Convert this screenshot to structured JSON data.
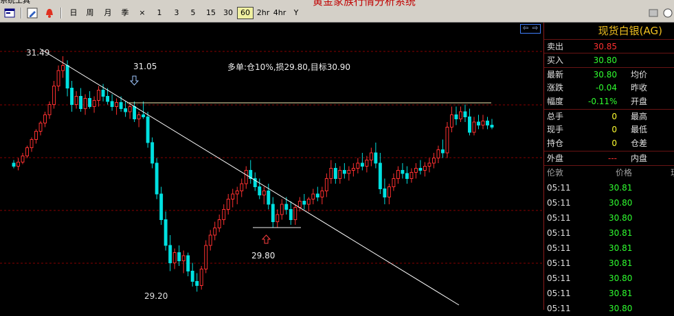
{
  "overlay_title": "黄金家族行情分析系统",
  "toolbar": {
    "periods": [
      "日",
      "周",
      "月",
      "季"
    ],
    "close_label": "×",
    "minutes": [
      "1",
      "3",
      "5",
      "15",
      "30",
      "60",
      "2hr",
      "4hr",
      "Y"
    ],
    "selected": "60"
  },
  "chart": {
    "high_label": "31.49",
    "low_label": "29.20",
    "entry_label": "29.80",
    "resistance_label": "31.05",
    "note": "多单:仓10%,损29.80,目标30.90"
  },
  "panel": {
    "title": "现货白银(AG)",
    "sell_label": "卖出",
    "sell_value": "30.85",
    "buy_label": "买入",
    "buy_value": "30.80",
    "latest_label": "最新",
    "latest_value": "30.80",
    "avg_label": "均价",
    "change_label": "涨跌",
    "change_value": "-0.04",
    "prev_close_label": "昨收",
    "amplitude_label": "幅度",
    "amplitude_value": "-0.11%",
    "open_label": "开盘",
    "total_label": "总手",
    "total_value": "0",
    "high_label": "最高",
    "current_label": "现手",
    "current_value": "0",
    "low_label": "最低",
    "position_label": "持仓",
    "position_value": "0",
    "position_diff_label": "仓差",
    "outer_label": "外盘",
    "outer_value": "---",
    "inner_label": "内盘",
    "col_time": "伦敦",
    "col_price": "价格",
    "ticks": [
      {
        "time": "05:11",
        "price": "30.81"
      },
      {
        "time": "05:11",
        "price": "30.80"
      },
      {
        "time": "05:11",
        "price": "30.80"
      },
      {
        "time": "05:11",
        "price": "30.81"
      },
      {
        "time": "05:11",
        "price": "30.81"
      },
      {
        "time": "05:11",
        "price": "30.81"
      },
      {
        "time": "05:11",
        "price": "30.80"
      },
      {
        "time": "05:11",
        "price": "30.81"
      },
      {
        "time": "05:11",
        "price": "30.80"
      }
    ]
  },
  "colors": {
    "up": "#ff3030",
    "down": "#00e0e0",
    "grid": "#8a0000"
  },
  "chart_data": {
    "type": "candlestick",
    "symbol": "现货白银(AG)",
    "period": "60",
    "ylim": [
      29.15,
      31.55
    ],
    "candles": [
      [
        30.45,
        30.48,
        30.4,
        30.42
      ],
      [
        30.42,
        30.5,
        30.38,
        30.46
      ],
      [
        30.46,
        30.55,
        30.44,
        30.52
      ],
      [
        30.52,
        30.62,
        30.5,
        30.6
      ],
      [
        30.6,
        30.7,
        30.56,
        30.68
      ],
      [
        30.68,
        30.78,
        30.64,
        30.76
      ],
      [
        30.76,
        30.86,
        30.72,
        30.84
      ],
      [
        30.84,
        30.95,
        30.8,
        30.92
      ],
      [
        30.92,
        31.05,
        30.88,
        31.02
      ],
      [
        31.02,
        31.25,
        30.98,
        31.2
      ],
      [
        31.2,
        31.4,
        31.15,
        31.35
      ],
      [
        31.35,
        31.49,
        31.28,
        31.4
      ],
      [
        31.4,
        31.45,
        31.1,
        31.18
      ],
      [
        31.18,
        31.25,
        30.95,
        31.02
      ],
      [
        31.02,
        31.15,
        30.98,
        31.1
      ],
      [
        31.1,
        31.18,
        30.95,
        30.98
      ],
      [
        30.98,
        31.12,
        30.92,
        31.08
      ],
      [
        31.08,
        31.15,
        30.98,
        31.0
      ],
      [
        31.0,
        31.1,
        30.94,
        31.06
      ],
      [
        31.06,
        31.2,
        31.0,
        31.16
      ],
      [
        31.16,
        31.22,
        31.05,
        31.1
      ],
      [
        31.1,
        31.18,
        31.02,
        31.05
      ],
      [
        31.05,
        31.12,
        30.96,
        31.0
      ],
      [
        31.0,
        31.08,
        30.92,
        31.04
      ],
      [
        31.04,
        31.1,
        30.95,
        30.98
      ],
      [
        30.98,
        31.05,
        30.9,
        30.95
      ],
      [
        30.95,
        31.02,
        30.88,
        31.0
      ],
      [
        31.0,
        31.05,
        30.85,
        30.88
      ],
      [
        30.88,
        30.95,
        30.8,
        30.92
      ],
      [
        30.92,
        31.05,
        30.88,
        30.9
      ],
      [
        30.9,
        30.95,
        30.6,
        30.65
      ],
      [
        30.65,
        30.7,
        30.4,
        30.45
      ],
      [
        30.45,
        30.5,
        30.1,
        30.15
      ],
      [
        30.15,
        30.22,
        29.85,
        29.9
      ],
      [
        29.9,
        29.98,
        29.6,
        29.65
      ],
      [
        29.65,
        29.75,
        29.4,
        29.48
      ],
      [
        29.48,
        29.62,
        29.42,
        29.58
      ],
      [
        29.58,
        29.65,
        29.45,
        29.5
      ],
      [
        29.5,
        29.6,
        29.38,
        29.55
      ],
      [
        29.55,
        29.58,
        29.35,
        29.4
      ],
      [
        29.4,
        29.48,
        29.25,
        29.3
      ],
      [
        29.3,
        29.38,
        29.2,
        29.26
      ],
      [
        29.26,
        29.45,
        29.22,
        29.42
      ],
      [
        29.42,
        29.7,
        29.38,
        29.65
      ],
      [
        29.65,
        29.8,
        29.6,
        29.75
      ],
      [
        29.75,
        29.88,
        29.7,
        29.82
      ],
      [
        29.82,
        29.95,
        29.78,
        29.9
      ],
      [
        29.9,
        30.05,
        29.85,
        30.0
      ],
      [
        30.0,
        30.15,
        29.95,
        30.1
      ],
      [
        30.1,
        30.2,
        30.02,
        30.15
      ],
      [
        30.15,
        30.22,
        30.05,
        30.18
      ],
      [
        30.18,
        30.3,
        30.12,
        30.25
      ],
      [
        30.25,
        30.42,
        30.2,
        30.38
      ],
      [
        30.38,
        30.48,
        30.25,
        30.3
      ],
      [
        30.3,
        30.36,
        30.18,
        30.22
      ],
      [
        30.22,
        30.3,
        30.1,
        30.14
      ],
      [
        30.14,
        30.22,
        30.05,
        30.18
      ],
      [
        30.18,
        30.25,
        30.0,
        30.05
      ],
      [
        30.05,
        30.12,
        29.82,
        29.88
      ],
      [
        29.88,
        30.0,
        29.82,
        29.95
      ],
      [
        29.95,
        30.1,
        29.9,
        30.05
      ],
      [
        30.05,
        30.12,
        29.95,
        30.0
      ],
      [
        30.0,
        30.08,
        29.85,
        29.9
      ],
      [
        29.9,
        30.05,
        29.85,
        30.02
      ],
      [
        30.02,
        30.12,
        29.98,
        30.08
      ],
      [
        30.08,
        30.15,
        30.0,
        30.05
      ],
      [
        30.05,
        30.12,
        29.98,
        30.1
      ],
      [
        30.1,
        30.2,
        30.05,
        30.15
      ],
      [
        30.15,
        30.22,
        30.08,
        30.12
      ],
      [
        30.12,
        30.22,
        30.05,
        30.18
      ],
      [
        30.18,
        30.35,
        30.12,
        30.3
      ],
      [
        30.3,
        30.48,
        30.25,
        30.4
      ],
      [
        30.4,
        30.45,
        30.25,
        30.3
      ],
      [
        30.3,
        30.42,
        30.25,
        30.38
      ],
      [
        30.38,
        30.45,
        30.3,
        30.35
      ],
      [
        30.35,
        30.42,
        30.28,
        30.38
      ],
      [
        30.38,
        30.45,
        30.32,
        30.4
      ],
      [
        30.4,
        30.5,
        30.35,
        30.45
      ],
      [
        30.45,
        30.55,
        30.38,
        30.42
      ],
      [
        30.42,
        30.52,
        30.36,
        30.48
      ],
      [
        30.48,
        30.6,
        30.42,
        30.55
      ],
      [
        30.55,
        30.65,
        30.4,
        30.45
      ],
      [
        30.45,
        30.55,
        30.15,
        30.2
      ],
      [
        30.2,
        30.3,
        30.05,
        30.12
      ],
      [
        30.12,
        30.25,
        30.05,
        30.22
      ],
      [
        30.22,
        30.35,
        30.18,
        30.3
      ],
      [
        30.3,
        30.42,
        30.25,
        30.38
      ],
      [
        30.38,
        30.45,
        30.3,
        30.35
      ],
      [
        30.35,
        30.42,
        30.25,
        30.3
      ],
      [
        30.3,
        30.4,
        30.26,
        30.36
      ],
      [
        30.36,
        30.45,
        30.3,
        30.4
      ],
      [
        30.4,
        30.48,
        30.34,
        30.38
      ],
      [
        30.38,
        30.46,
        30.32,
        30.42
      ],
      [
        30.42,
        30.5,
        30.36,
        30.45
      ],
      [
        30.45,
        30.55,
        30.4,
        30.5
      ],
      [
        30.5,
        30.62,
        30.45,
        30.58
      ],
      [
        30.58,
        30.68,
        30.5,
        30.55
      ],
      [
        30.55,
        30.85,
        30.5,
        30.8
      ],
      [
        30.8,
        31.0,
        30.75,
        30.92
      ],
      [
        30.92,
        31.0,
        30.82,
        30.88
      ],
      [
        30.88,
        31.0,
        30.85,
        30.95
      ],
      [
        30.95,
        31.02,
        30.85,
        30.9
      ],
      [
        30.9,
        30.98,
        30.72,
        30.75
      ],
      [
        30.75,
        30.9,
        30.72,
        30.85
      ],
      [
        30.85,
        30.92,
        30.78,
        30.82
      ],
      [
        30.82,
        30.92,
        30.78,
        30.86
      ],
      [
        30.86,
        30.9,
        30.78,
        30.82
      ],
      [
        30.82,
        30.88,
        30.78,
        30.8
      ]
    ]
  }
}
